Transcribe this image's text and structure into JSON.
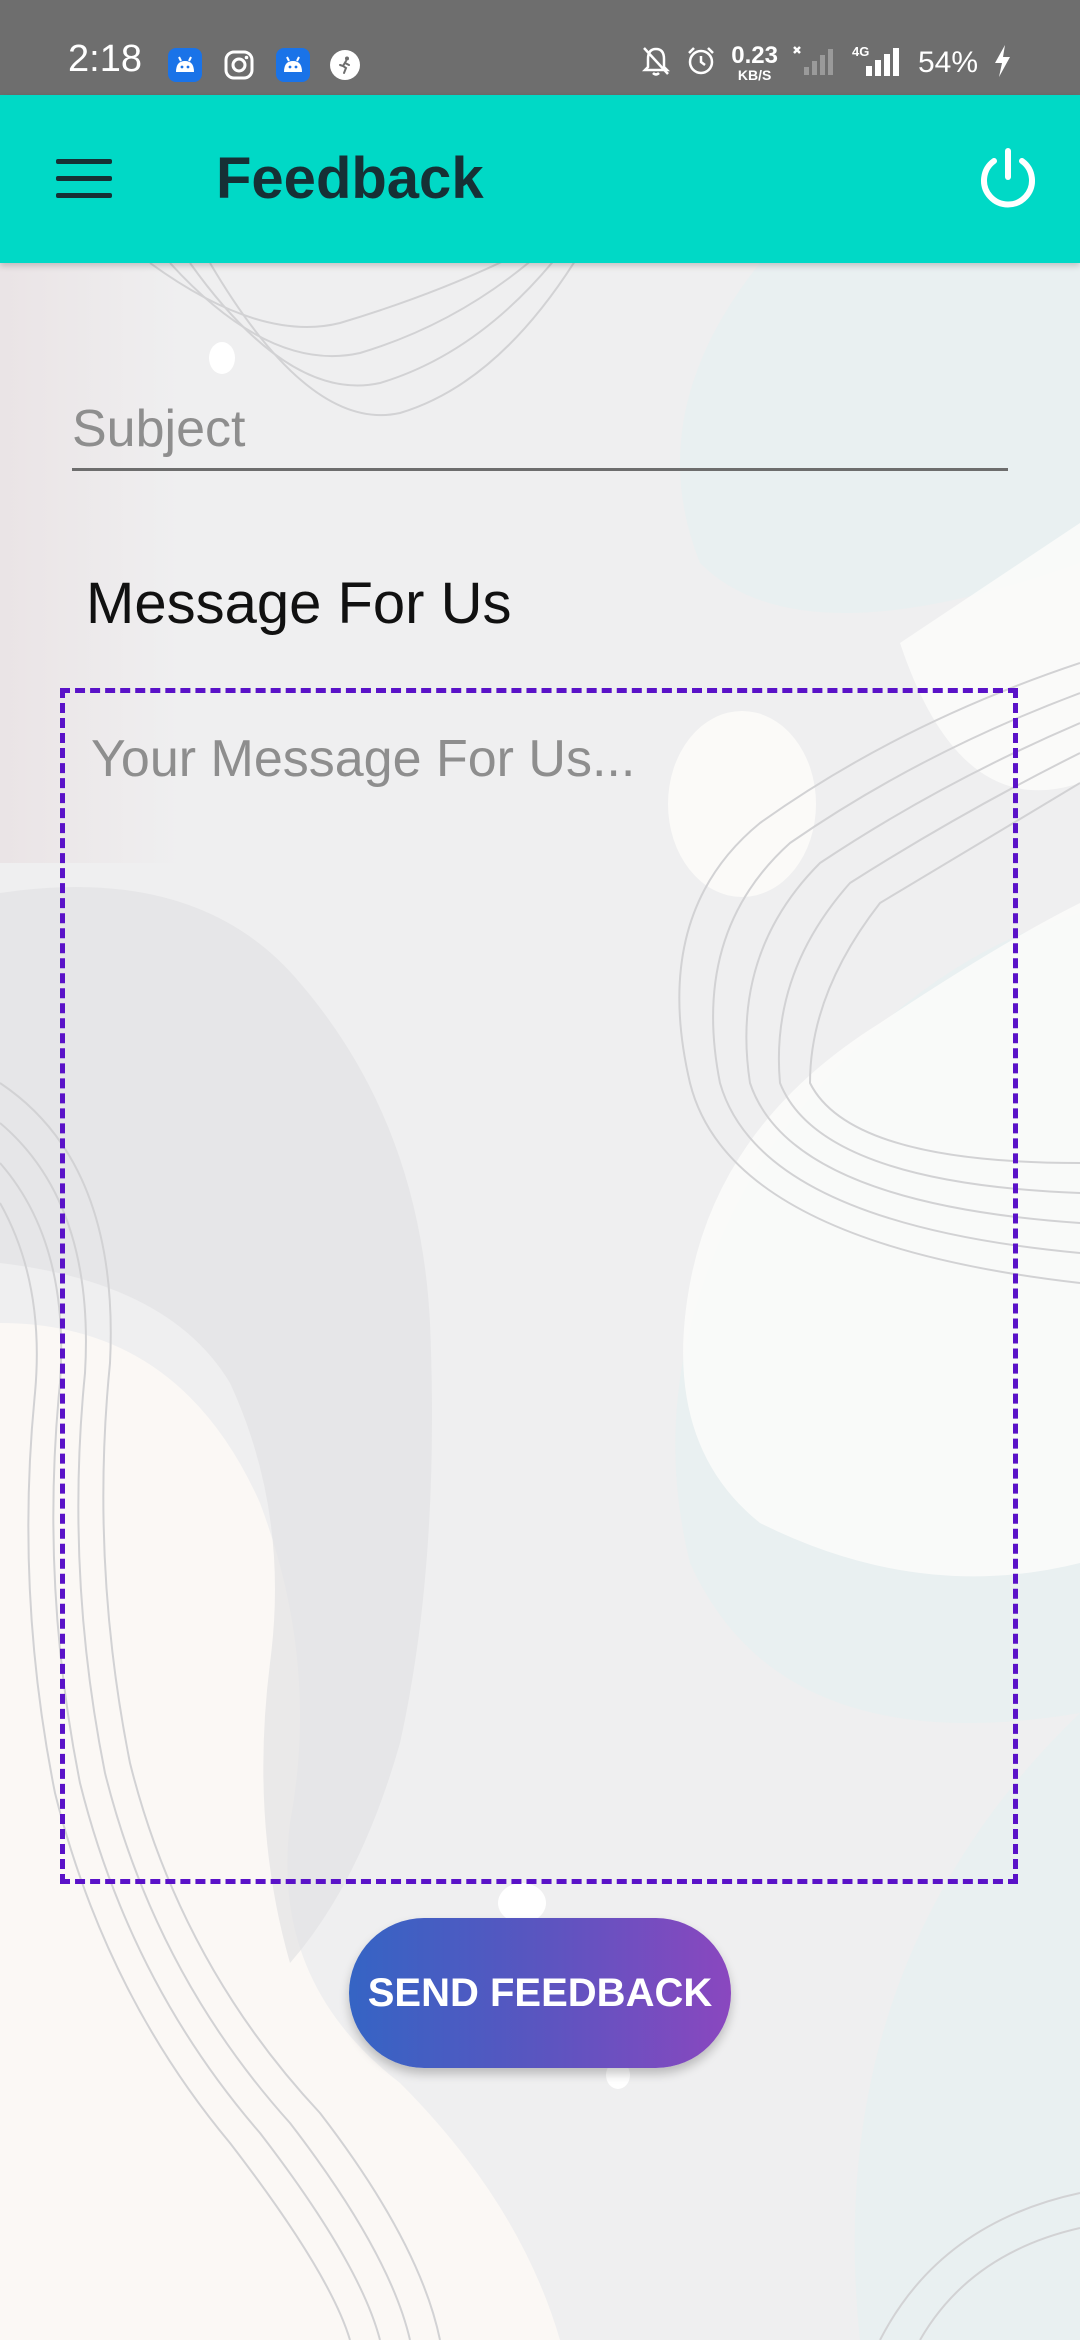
{
  "status_bar": {
    "time": "2:18",
    "net_speed_value": "0.23",
    "net_speed_unit": "KB/S",
    "network_type": "4G",
    "battery": "54%",
    "notification_icons": [
      "android-icon",
      "instagram-icon",
      "android-icon",
      "running-icon"
    ],
    "system_icons": [
      "bell-off-icon",
      "alarm-icon",
      "signal-x-icon",
      "signal-4g-icon",
      "charging-icon"
    ]
  },
  "app_bar": {
    "title": "Feedback",
    "background_color": "#00d9c6",
    "menu_icon": "hamburger-menu-icon",
    "power_icon": "power-icon"
  },
  "form": {
    "subject_placeholder": "Subject",
    "subject_value": "",
    "message_label": "Message For Us",
    "message_placeholder": "Your Message For Us...",
    "message_value": "",
    "message_border_color": "#5a12c8"
  },
  "send_button": {
    "label": "SEND FEEDBACK"
  }
}
